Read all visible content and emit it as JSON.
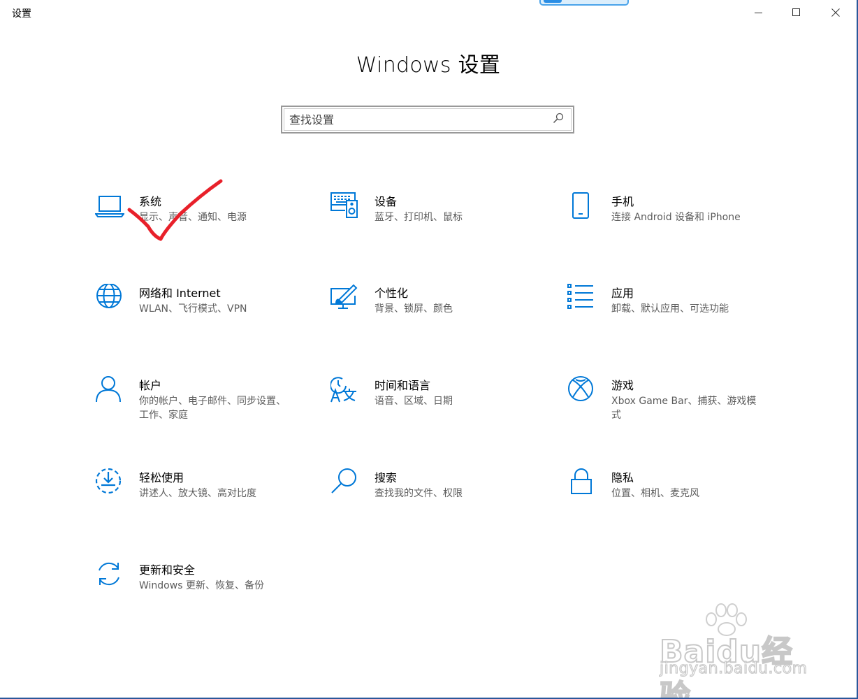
{
  "window": {
    "app_title": "设置",
    "page_title": "Windows 设置"
  },
  "search": {
    "placeholder": "查找设置"
  },
  "tiles": [
    {
      "name": "系统",
      "desc": "显示、声音、通知、电源",
      "icon": "laptop-icon"
    },
    {
      "name": "设备",
      "desc": "蓝牙、打印机、鼠标",
      "icon": "devices-icon"
    },
    {
      "name": "手机",
      "desc": "连接 Android 设备和 iPhone",
      "icon": "phone-icon"
    },
    {
      "name": "网络和 Internet",
      "desc": "WLAN、飞行模式、VPN",
      "icon": "globe-icon"
    },
    {
      "name": "个性化",
      "desc": "背景、锁屏、颜色",
      "icon": "personalization-icon"
    },
    {
      "name": "应用",
      "desc": "卸载、默认应用、可选功能",
      "icon": "apps-list-icon"
    },
    {
      "name": "帐户",
      "desc": "你的帐户、电子邮件、同步设置、工作、家庭",
      "icon": "person-icon"
    },
    {
      "name": "时间和语言",
      "desc": "语音、区域、日期",
      "icon": "time-language-icon"
    },
    {
      "name": "游戏",
      "desc": "Xbox Game Bar、捕获、游戏模式",
      "icon": "xbox-icon"
    },
    {
      "name": "轻松使用",
      "desc": "讲述人、放大镜、高对比度",
      "icon": "ease-of-access-icon"
    },
    {
      "name": "搜索",
      "desc": "查找我的文件、权限",
      "icon": "search-icon"
    },
    {
      "name": "隐私",
      "desc": "位置、相机、麦克风",
      "icon": "lock-icon"
    },
    {
      "name": "更新和安全",
      "desc": "Windows 更新、恢复、备份",
      "icon": "sync-icon"
    }
  ],
  "watermark": {
    "brand": "Baidu经验",
    "url": "jingyan.baidu.com"
  },
  "colors": {
    "accent": "#0078d7",
    "annotation": "#e8202a",
    "description_text": "#5c5c5c"
  }
}
